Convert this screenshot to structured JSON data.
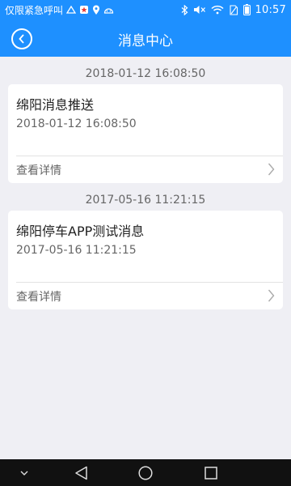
{
  "status_bar": {
    "carrier": "仅限紧急呼叫",
    "time": "10:57",
    "icons": [
      "signal-icon",
      "notification-icon",
      "location-icon",
      "android-icon",
      "bluetooth-icon",
      "mute-icon",
      "wifi-icon",
      "no-sim-icon",
      "battery-icon"
    ]
  },
  "header": {
    "title": "消息中心",
    "back_icon": "back-arrow-icon"
  },
  "messages": [
    {
      "date": "2018-01-12 16:08:50",
      "title": "绵阳消息推送",
      "time": "2018-01-12 16:08:50",
      "detail_label": "查看详情"
    },
    {
      "date": "2017-05-16 11:21:15",
      "title": "绵阳停车APP测试消息",
      "time": "2017-05-16 11:21:15",
      "detail_label": "查看详情"
    }
  ],
  "nav_bar": {
    "buttons": [
      "collapse-icon",
      "back-icon",
      "home-icon",
      "recents-icon"
    ]
  },
  "colors": {
    "accent": "#1e90ff",
    "background": "#efeff4",
    "card": "#ffffff",
    "nav": "#111111"
  }
}
